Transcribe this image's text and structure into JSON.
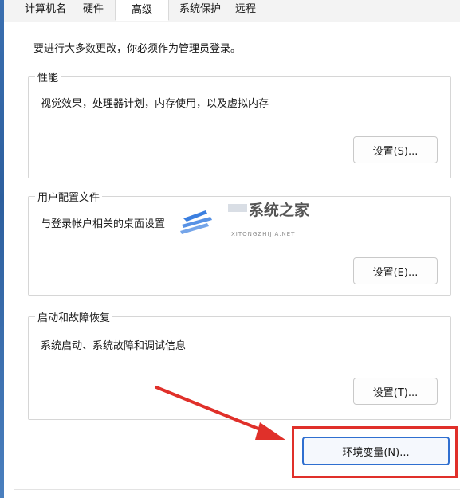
{
  "tabs": [
    {
      "label": "计算机名",
      "active": false
    },
    {
      "label": "硬件",
      "active": false
    },
    {
      "label": "高级",
      "active": true
    },
    {
      "label": "系统保护",
      "active": false
    },
    {
      "label": "远程",
      "active": false
    }
  ],
  "admin_note": "要进行大多数更改，你必须作为管理员登录。",
  "performance": {
    "title": "性能",
    "description": "视觉效果，处理器计划，内存使用，以及虚拟内存",
    "button": "设置(S)..."
  },
  "user_profiles": {
    "title": "用户配置文件",
    "description": "与登录帐户相关的桌面设置",
    "button": "设置(E)..."
  },
  "startup_recovery": {
    "title": "启动和故障恢复",
    "description": "系统启动、系统故障和调试信息",
    "button": "设置(T)..."
  },
  "env_button": "环境变量(N)...",
  "watermark": {
    "title": "系统之家",
    "url": "XITONGZHIJIA.NET"
  },
  "colors": {
    "highlight": "#e0302a",
    "accent": "#2f6fd0"
  }
}
